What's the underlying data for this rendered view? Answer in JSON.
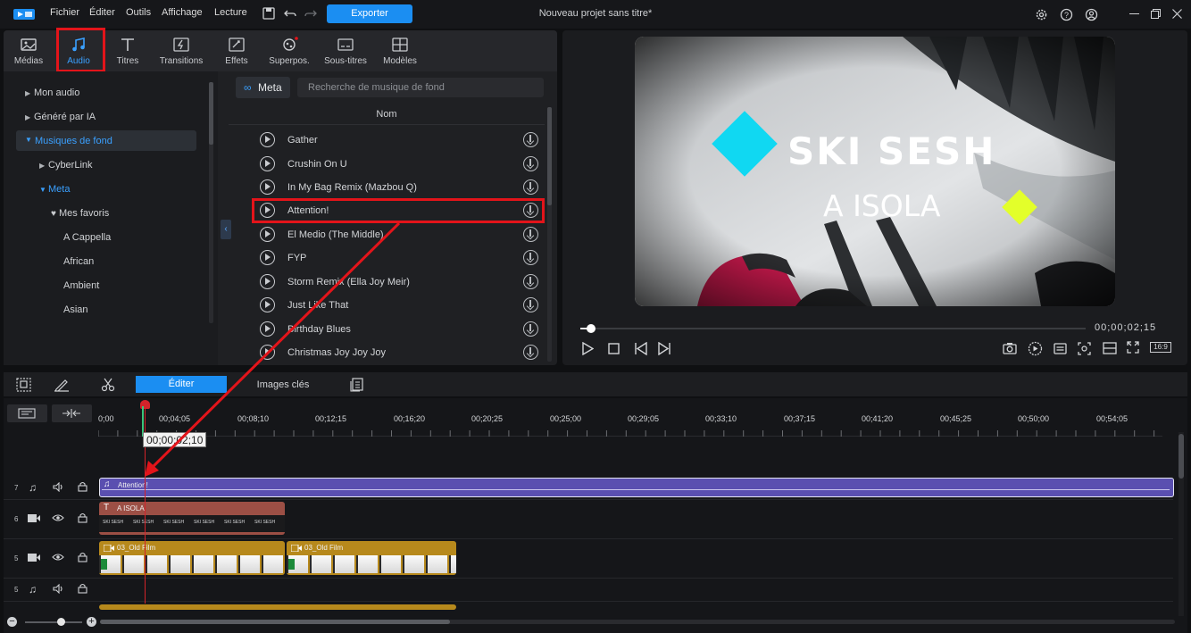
{
  "app": {
    "menu": [
      "Fichier",
      "Éditer",
      "Outils",
      "Affichage",
      "Lecture"
    ],
    "export_label": "Exporter",
    "project_title": "Nouveau projet sans titre*"
  },
  "library": {
    "tabs": [
      "Médias",
      "Audio",
      "Titres",
      "Transitions",
      "Effets",
      "Superpos.",
      "Sous-titres",
      "Modèles"
    ],
    "active_tab": "Audio",
    "tree": [
      "Mon audio",
      "Généré par IA",
      "Musiques de fond",
      "CyberLink",
      "Meta",
      "Mes favoris",
      "A Cappella",
      "African",
      "Ambient",
      "Asian"
    ],
    "meta_label": "Meta",
    "search_placeholder": "Recherche de musique de fond",
    "column_header": "Nom",
    "tracks": [
      "Gather",
      "Crushin On U",
      "In My Bag Remix (Mazbou Q)",
      "Attention!",
      "El Medio (The Middle)",
      "FYP",
      "Storm Remix (Ella Joy Meir)",
      "Just Like That",
      "Birthday Blues",
      "Christmas Joy Joy Joy"
    ],
    "highlighted_track": "Attention!"
  },
  "preview": {
    "title_text": "SKI SESH",
    "subtitle_text": "A ISOLA",
    "timecode": "00;00;02;15",
    "aspect": "16:9",
    "scrub_progress": 0.02
  },
  "edit_bar": {
    "tab_edit": "Éditer",
    "tab_keyframes": "Images clés"
  },
  "timeline": {
    "ruler": [
      "0;00",
      "00;04;05",
      "00;08;10",
      "00;12;15",
      "00;16;20",
      "00;20;25",
      "00;25;00",
      "00;29;05",
      "00;33;10",
      "00;37;15",
      "00;41;20",
      "00;45;25",
      "00;50;00",
      "00;54;05"
    ],
    "playhead_time": "00;00;02;10",
    "tracks": [
      {
        "num": "7",
        "type": "audio"
      },
      {
        "num": "6",
        "type": "video"
      },
      {
        "num": "5",
        "type": "video"
      },
      {
        "num": "5",
        "type": "audio"
      }
    ],
    "clips": {
      "audio_attention": "Attention!",
      "title_clip": "A ISOLA",
      "film_1": "03_Old Film",
      "film_2": "03_Old Film",
      "thumb_text": "SKI SESH"
    }
  },
  "colors": {
    "accent": "#1b8ef2",
    "highlight": "#e3141a",
    "audio_clip": "#5a4fb0",
    "title_clip": "#9c4f45",
    "film_clip": "#b7891c"
  }
}
